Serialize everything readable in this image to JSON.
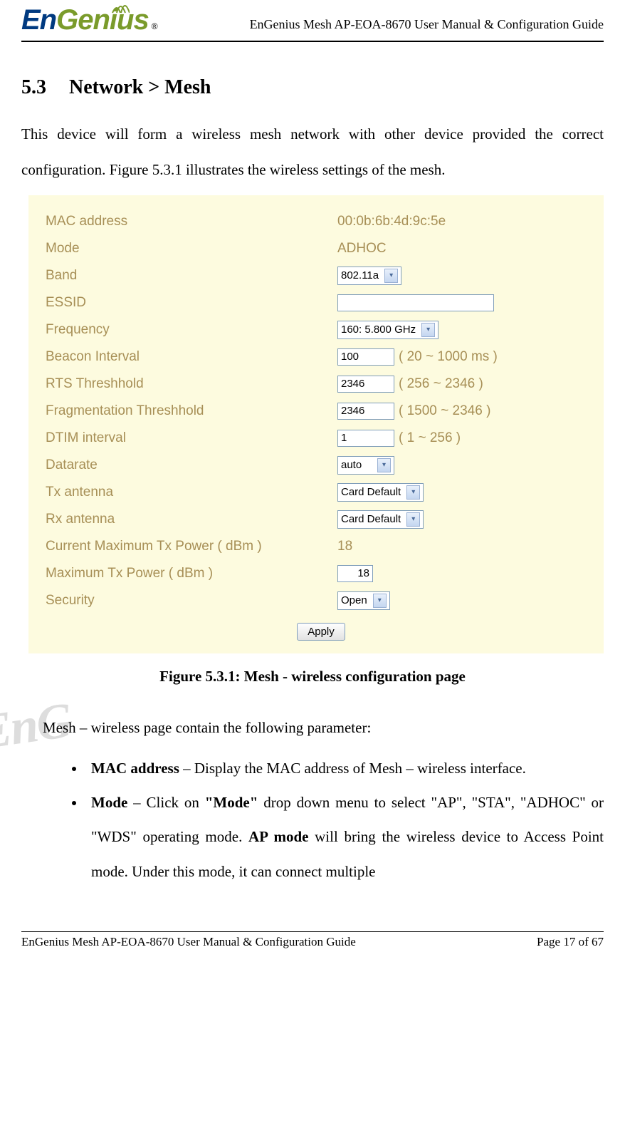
{
  "header": {
    "logo_en": "En",
    "logo_genius": "Genius",
    "logo_reg": "®",
    "title": "EnGenius Mesh AP-EOA-8670 User Manual & Configuration Guide"
  },
  "section": {
    "number": "5.3",
    "title": "Network > Mesh"
  },
  "intro_paragraph": "This device will form a wireless mesh network with other device provided the correct configuration. Figure 5.3.1 illustrates the wireless settings of the mesh.",
  "figure": {
    "mac_label": "MAC address",
    "mac_value": "00:0b:6b:4d:9c:5e",
    "mode_label": "Mode",
    "mode_value": "ADHOC",
    "band_label": "Band",
    "band_value": "802.11a",
    "essid_label": "ESSID",
    "essid_value": "",
    "freq_label": "Frequency",
    "freq_value": "160: 5.800 GHz",
    "beacon_label": "Beacon Interval",
    "beacon_value": "100",
    "beacon_hint": "( 20 ~ 1000 ms )",
    "rts_label": "RTS Threshhold",
    "rts_value": "2346",
    "rts_hint": "( 256 ~ 2346 )",
    "frag_label": "Fragmentation Threshhold",
    "frag_value": "2346",
    "frag_hint": "( 1500 ~ 2346 )",
    "dtim_label": "DTIM interval",
    "dtim_value": "1",
    "dtim_hint": "( 1 ~ 256 )",
    "datarate_label": "Datarate",
    "datarate_value": "auto",
    "tx_label": "Tx antenna",
    "tx_value": "Card Default",
    "rx_label": "Rx antenna",
    "rx_value": "Card Default",
    "curmax_label": "Current Maximum Tx Power ( dBm )",
    "curmax_value": "18",
    "max_label": "Maximum Tx Power ( dBm )",
    "max_value": "18",
    "security_label": "Security",
    "security_value": "Open",
    "apply_btn": "Apply"
  },
  "figure_caption": "Figure 5.3.1: Mesh - wireless configuration page",
  "param_intro": "Mesh – wireless page contain the following parameter:",
  "params": {
    "mac_b": "MAC address",
    "mac_rest": " – Display the MAC address of Mesh – wireless interface.",
    "mode_b": "Mode",
    "mode_mid1": " – Click on ",
    "mode_b2": "\"Mode\"",
    "mode_mid2": " drop down menu to select \"AP\", \"STA\", \"ADHOC\" or \"WDS\" operating mode. ",
    "mode_b3": "AP mode",
    "mode_rest": " will bring the wireless device to Access Point mode. Under this mode, it can connect multiple"
  },
  "footer": {
    "left": "EnGenius Mesh AP-EOA-8670 User Manual & Configuration Guide",
    "right": "Page 17 of 67"
  },
  "watermark": "EnG"
}
